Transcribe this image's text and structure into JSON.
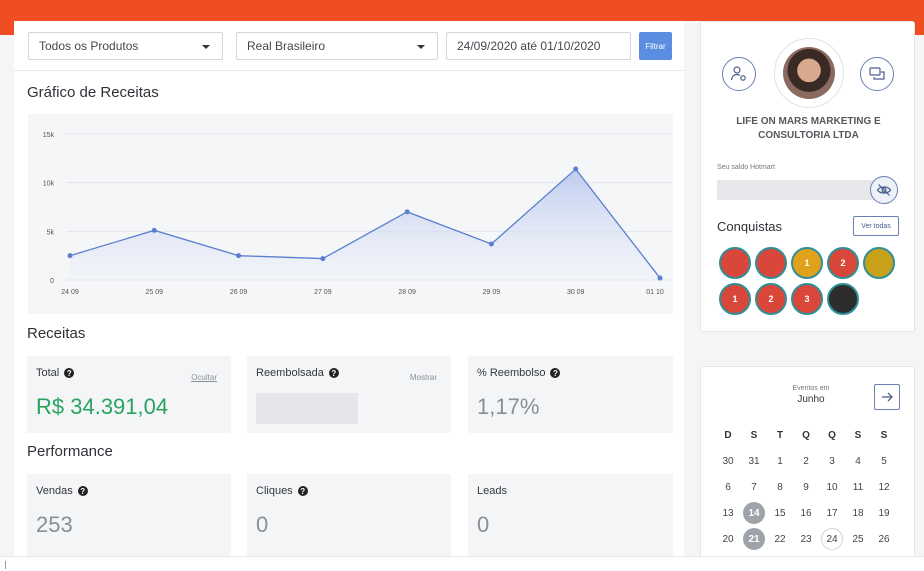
{
  "filters": {
    "product": "Todos os Produtos",
    "currency": "Real Brasileiro",
    "date_range": "24/09/2020 até 01/10/2020",
    "filter_button": "Filtrar"
  },
  "chart_section_title": "Gráfico de Receitas",
  "chart_data": {
    "type": "area",
    "categories": [
      "24 09",
      "25 09",
      "26 09",
      "27 09",
      "28 09",
      "29 09",
      "30 09",
      "01 10"
    ],
    "values": [
      2500,
      5100,
      2500,
      2200,
      7000,
      3700,
      11400,
      200
    ],
    "ylim": [
      0,
      15000
    ],
    "yticks": [
      0,
      5000,
      10000,
      15000
    ],
    "ytick_labels": [
      "0",
      "5k",
      "10k",
      "15k"
    ],
    "grid": true,
    "line_color": "#5b7fd0"
  },
  "receitas": {
    "title": "Receitas",
    "total": {
      "label": "Total",
      "link": "Ocultar",
      "value": "R$ 34.391,04"
    },
    "reembolsada": {
      "label": "Reembolsada",
      "link": "Mostrar"
    },
    "reembolso_pct": {
      "label": "% Reembolso",
      "value": "1,17%"
    }
  },
  "performance": {
    "title": "Performance",
    "vendas": {
      "label": "Vendas",
      "value": "253"
    },
    "cliques": {
      "label": "Cliques",
      "value": "0"
    },
    "leads": {
      "label": "Leads",
      "value": "0"
    }
  },
  "profile": {
    "company": "LIFE ON MARS MARKETING E CONSULTORIA LTDA",
    "saldo_label": "Seu saldo Hotmart",
    "conquistas_title": "Conquistas",
    "ver_todas": "Ver todas",
    "badges": [
      {
        "label": "",
        "color": "#d9463a"
      },
      {
        "label": "",
        "color": "#d9463a"
      },
      {
        "label": "1",
        "color": "#e0a21a"
      },
      {
        "label": "2",
        "color": "#d9463a"
      },
      {
        "label": "",
        "color": "#c7a11a"
      },
      {
        "label": "1",
        "color": "#d9463a"
      },
      {
        "label": "2",
        "color": "#d9463a"
      },
      {
        "label": "3",
        "color": "#d9463a"
      },
      {
        "label": "",
        "color": "#2d2d2d"
      }
    ]
  },
  "calendar": {
    "events_label": "Eventos em",
    "month": "Junho",
    "weekdays": [
      "D",
      "S",
      "T",
      "Q",
      "Q",
      "S",
      "S"
    ],
    "weeks": [
      [
        "30",
        "31",
        "1",
        "2",
        "3",
        "4",
        "5"
      ],
      [
        "6",
        "7",
        "8",
        "9",
        "10",
        "11",
        "12"
      ],
      [
        "13",
        "14",
        "15",
        "16",
        "17",
        "18",
        "19"
      ],
      [
        "20",
        "21",
        "22",
        "23",
        "24",
        "25",
        "26"
      ]
    ],
    "selected": [
      "14",
      "21"
    ],
    "today": "24"
  }
}
